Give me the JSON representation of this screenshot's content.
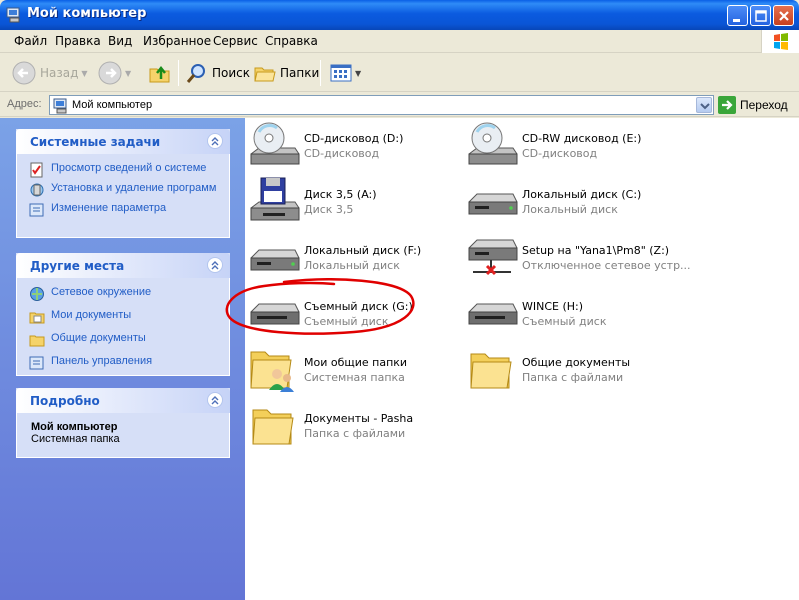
{
  "window": {
    "title": "Мой компьютер"
  },
  "menu": [
    "Файл",
    "Правка",
    "Вид",
    "Избранное",
    "Сервис",
    "Справка"
  ],
  "toolbar": {
    "back_label": "Назад",
    "search_label": "Поиск",
    "folders_label": "Папки"
  },
  "address": {
    "label": "Адрес:",
    "value": "Мой компьютер",
    "go_label": "Переход"
  },
  "sidebar": {
    "system_tasks": {
      "title": "Системные задачи",
      "items": [
        "Просмотр сведений о системе",
        "Установка и удаление программ",
        "Изменение параметра"
      ]
    },
    "other_places": {
      "title": "Другие места",
      "items": [
        "Сетевое окружение",
        "Мои документы",
        "Общие документы",
        "Панель управления"
      ]
    },
    "details": {
      "title": "Подробно",
      "name": "Мой компьютер",
      "type": "Системная папка"
    }
  },
  "items": [
    {
      "name": "CD-дисковод (D:)",
      "type": "CD-дисковод",
      "icon": "cd-drive-icon"
    },
    {
      "name": "CD-RW дисковод (E:)",
      "type": "CD-дисковод",
      "icon": "cd-drive-icon"
    },
    {
      "name": "Диск 3,5 (A:)",
      "type": "Диск 3,5",
      "icon": "floppy-drive-icon"
    },
    {
      "name": "Локальный диск (C:)",
      "type": "Локальный диск",
      "icon": "hard-drive-icon"
    },
    {
      "name": "Локальный диск (F:)",
      "type": "Локальный диск",
      "icon": "hard-drive-icon"
    },
    {
      "name": "Setup на \"Yana1\\Pm8\" (Z:)",
      "type": "Отключенное сетевое устр...",
      "icon": "network-drive-icon"
    },
    {
      "name": "Съемный диск (G:)",
      "type": "Съемный диск",
      "icon": "removable-drive-icon"
    },
    {
      "name": "WINCE (H:)",
      "type": "Съемный диск",
      "icon": "removable-drive-icon"
    },
    {
      "name": "Мои общие папки",
      "type": "Системная папка",
      "icon": "shared-folder-icon"
    },
    {
      "name": "Общие документы",
      "type": "Папка с файлами",
      "icon": "folder-icon"
    },
    {
      "name": "Документы - Pasha",
      "type": "Папка с файлами",
      "icon": "folder-icon"
    }
  ],
  "colors": {
    "titlebar": "#0a55d6",
    "panel_link": "#215dc6",
    "annotation": "#e00000"
  }
}
